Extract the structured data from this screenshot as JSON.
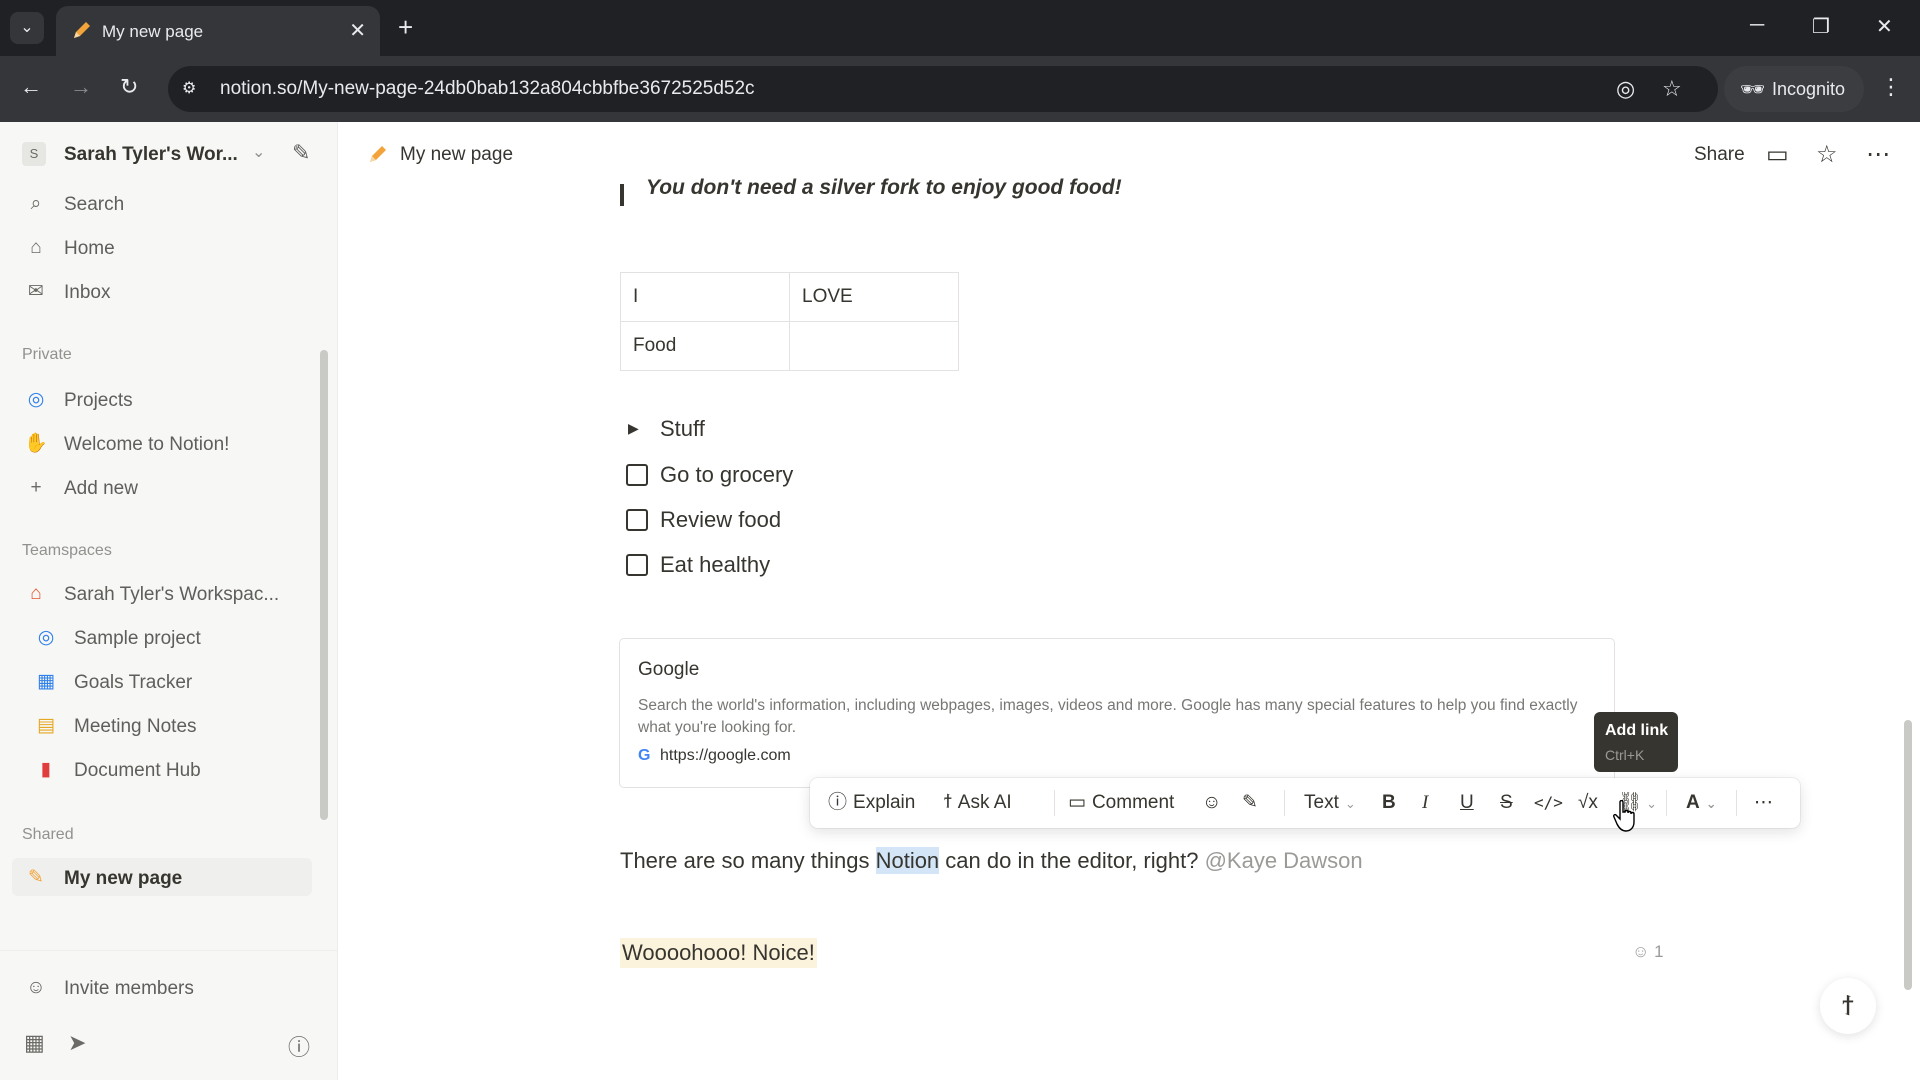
{
  "browser": {
    "tab_title": "My new page",
    "url": "notion.so/My-new-page-24db0bab132a804cbbfbe3672525d52c",
    "incognito_label": "Incognito"
  },
  "sidebar": {
    "workspace_name": "Sarah Tyler's Wor...",
    "workspace_initial": "S",
    "top_items": [
      {
        "label": "Search",
        "icon": "search-icon"
      },
      {
        "label": "Home",
        "icon": "home-icon"
      },
      {
        "label": "Inbox",
        "icon": "inbox-icon"
      }
    ],
    "private_label": "Private",
    "private_items": [
      {
        "label": "Projects",
        "icon": "projects-icon"
      },
      {
        "label": "Welcome to Notion!",
        "icon": "wave-icon"
      },
      {
        "label": "Add new",
        "icon": "plus-icon"
      }
    ],
    "teamspaces_label": "Teamspaces",
    "teamspace_name": "Sarah Tyler's Workspac...",
    "teamspace_items": [
      {
        "label": "Sample project",
        "icon": "target-icon"
      },
      {
        "label": "Goals Tracker",
        "icon": "chart-icon"
      },
      {
        "label": "Meeting Notes",
        "icon": "calendar-icon"
      },
      {
        "label": "Document Hub",
        "icon": "document-icon"
      }
    ],
    "shared_label": "Shared",
    "shared_items": [
      {
        "label": "My new page",
        "icon": "pencil-icon"
      }
    ],
    "invite_label": "Invite members"
  },
  "topbar": {
    "breadcrumb_title": "My new page",
    "share_label": "Share"
  },
  "content": {
    "quote": "You don't need a silver fork to enjoy good food!",
    "table": [
      [
        "I",
        "LOVE"
      ],
      [
        "Food",
        ""
      ]
    ],
    "toggle_label": "Stuff",
    "todos": [
      "Go to grocery",
      "Review food",
      "Eat healthy"
    ],
    "bookmark": {
      "title": "Google",
      "description": "Search the world's information, including webpages, images, videos and more. Google has many special features to help you find exactly what you're looking for.",
      "url": "https://google.com"
    },
    "paragraph_before": "There are so many things ",
    "paragraph_highlight": "Notion",
    "paragraph_after": " can do in the editor, right? ",
    "mention": "@Kaye Dawson",
    "highlight_text": "Woooohooo! Noice!",
    "reaction_count": "1"
  },
  "toolbar": {
    "explain_label": "Explain",
    "ask_ai_label": "Ask AI",
    "comment_label": "Comment",
    "text_type_label": "Text",
    "text_color_label": "A"
  },
  "tooltip": {
    "title": "Add link",
    "shortcut": "Ctrl+K"
  },
  "colors": {
    "accent_highlight": "#d3e5f7",
    "yellow_background": "#fbf3db",
    "sidebar_bg": "#f7f7f5"
  }
}
